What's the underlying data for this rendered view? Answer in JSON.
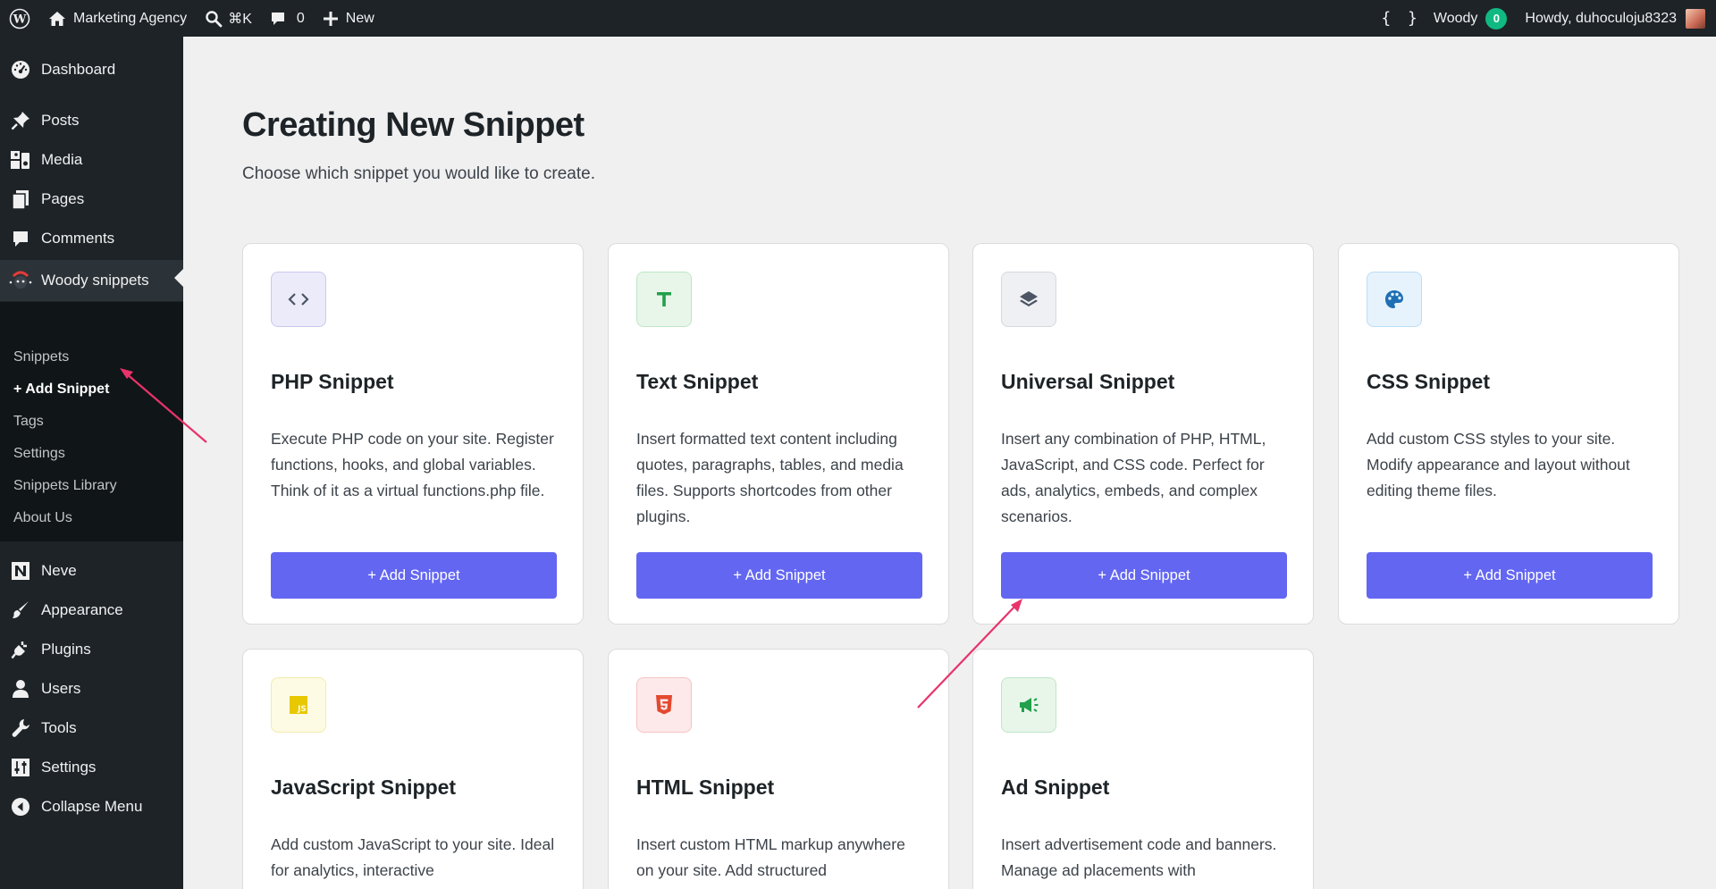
{
  "adminbar": {
    "site_name": "Marketing Agency",
    "search_shortcut": "⌘K",
    "comments_count": "0",
    "new_label": "New",
    "woody_braces": "{ }",
    "woody_label": "Woody",
    "woody_count": "0",
    "greeting": "Howdy, duhoculoju8323"
  },
  "sidebar": {
    "items": [
      {
        "label": "Dashboard",
        "icon": "dashboard-icon"
      },
      {
        "label": "Posts",
        "icon": "pin-icon"
      },
      {
        "label": "Media",
        "icon": "media-icon"
      },
      {
        "label": "Pages",
        "icon": "pages-icon"
      },
      {
        "label": "Comments",
        "icon": "comment-icon"
      },
      {
        "label": "Woody snippets",
        "icon": "woody-icon"
      },
      {
        "label": "Neve",
        "icon": "neve-icon"
      },
      {
        "label": "Appearance",
        "icon": "brush-icon"
      },
      {
        "label": "Plugins",
        "icon": "plug-icon"
      },
      {
        "label": "Users",
        "icon": "user-icon"
      },
      {
        "label": "Tools",
        "icon": "wrench-icon"
      },
      {
        "label": "Settings",
        "icon": "settings-icon"
      },
      {
        "label": "Collapse Menu",
        "icon": "collapse-icon"
      }
    ],
    "submenu": [
      "Snippets",
      "+ Add Snippet",
      "Tags",
      "Settings",
      "Snippets Library",
      "About Us"
    ]
  },
  "main": {
    "title": "Creating New Snippet",
    "subtitle": "Choose which snippet you would like to create.",
    "cards": [
      {
        "title": "PHP Snippet",
        "desc": "Execute PHP code on your site. Register functions, hooks, and global variables. Think of it as a virtual functions.php file.",
        "button": "+ Add Snippet",
        "icon": "code-icon",
        "icon_bg": "#ecebfa",
        "icon_color": "#4b5563"
      },
      {
        "title": "Text Snippet",
        "desc": "Insert formatted text content including quotes, paragraphs, tables, and media files. Supports shortcodes from other plugins.",
        "button": "+ Add Snippet",
        "icon": "text-icon",
        "icon_bg": "#e8f6ea",
        "icon_color": "#22a04b"
      },
      {
        "title": "Universal Snippet",
        "desc": "Insert any combination of PHP, HTML, JavaScript, and CSS code. Perfect for ads, analytics, embeds, and complex scenarios.",
        "button": "+ Add Snippet",
        "icon": "layers-icon",
        "icon_bg": "#eef0f3",
        "icon_color": "#4b5563"
      },
      {
        "title": "CSS Snippet",
        "desc": "Add custom CSS styles to your site. Modify appearance and layout without editing theme files.",
        "button": "+ Add Snippet",
        "icon": "palette-icon",
        "icon_bg": "#e6f3fc",
        "icon_color": "#1f6fb5"
      },
      {
        "title": "JavaScript Snippet",
        "desc": "Add custom JavaScript to your site. Ideal for analytics, interactive",
        "button": "",
        "icon": "js-icon",
        "icon_bg": "#fdfbe3",
        "icon_color": "#e8c800"
      },
      {
        "title": "HTML Snippet",
        "desc": "Insert custom HTML markup anywhere on your site. Add structured",
        "button": "",
        "icon": "html5-icon",
        "icon_bg": "#fde9e9",
        "icon_color": "#e3492f"
      },
      {
        "title": "Ad Snippet",
        "desc": "Insert advertisement code and banners. Manage ad placements with",
        "button": "",
        "icon": "megaphone-icon",
        "icon_bg": "#e8f6ea",
        "icon_color": "#22a04b"
      }
    ]
  }
}
